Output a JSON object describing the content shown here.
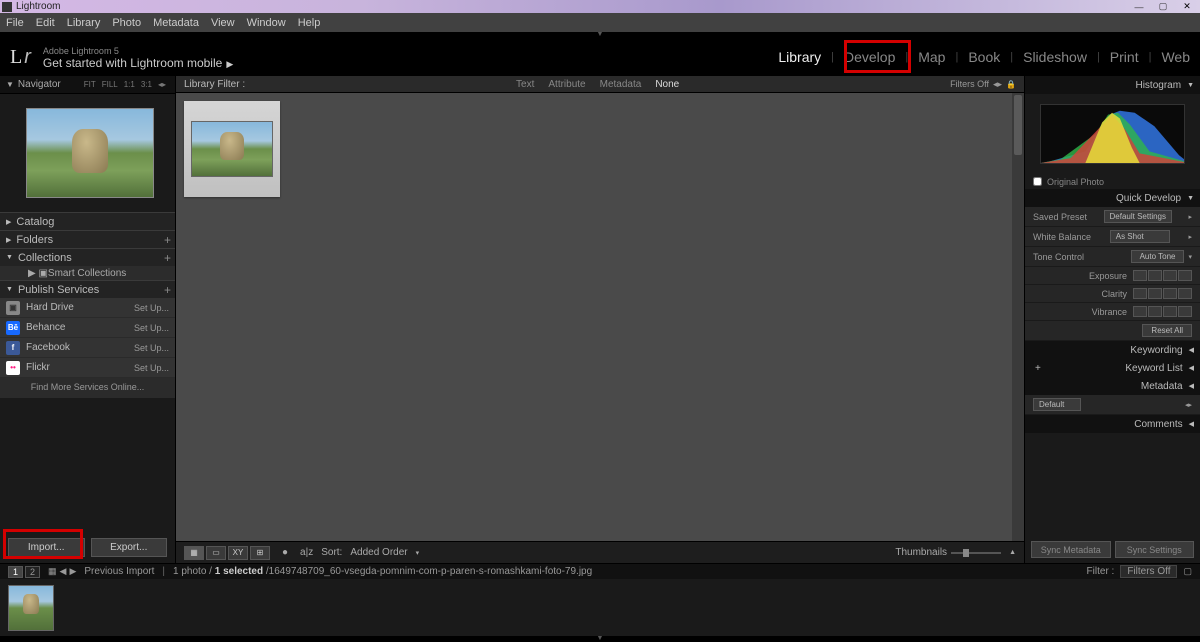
{
  "titlebar": {
    "app": "Lightroom"
  },
  "menubar": [
    "File",
    "Edit",
    "Library",
    "Photo",
    "Metadata",
    "View",
    "Window",
    "Help"
  ],
  "identity": {
    "small": "Adobe Lightroom 5",
    "big": "Get started with Lightroom mobile"
  },
  "modules": [
    "Library",
    "Develop",
    "Map",
    "Book",
    "Slideshow",
    "Print",
    "Web"
  ],
  "active_module": "Library",
  "left": {
    "navigator": {
      "title": "Navigator",
      "buttons": [
        "FIT",
        "FILL",
        "1:1",
        "3:1"
      ]
    },
    "catalog": "Catalog",
    "folders": "Folders",
    "collections": {
      "title": "Collections",
      "sub": "Smart Collections"
    },
    "publish": {
      "title": "Publish Services",
      "services": [
        {
          "icon": "hd",
          "name": "Hard Drive",
          "action": "Set Up..."
        },
        {
          "icon": "be",
          "name": "Behance",
          "action": "Set Up..."
        },
        {
          "icon": "fb",
          "name": "Facebook",
          "action": "Set Up..."
        },
        {
          "icon": "fl",
          "name": "Flickr",
          "action": "Set Up..."
        }
      ],
      "findmore": "Find More Services Online..."
    },
    "import": "Import...",
    "export": "Export..."
  },
  "libfilter": {
    "label": "Library Filter :",
    "tabs": [
      "Text",
      "Attribute",
      "Metadata",
      "None"
    ],
    "selected": "None",
    "right": "Filters Off"
  },
  "toolbar": {
    "sort_label": "Sort:",
    "sort_value": "Added Order",
    "thumb_label": "Thumbnails"
  },
  "right": {
    "histogram": "Histogram",
    "original": "Original Photo",
    "quickdev": {
      "title": "Quick Develop",
      "saved_preset": {
        "label": "Saved Preset",
        "value": "Default Settings"
      },
      "wb": {
        "label": "White Balance",
        "value": "As Shot"
      },
      "tone": {
        "label": "Tone Control",
        "button": "Auto Tone"
      },
      "exposure": "Exposure",
      "clarity": "Clarity",
      "vibrance": "Vibrance",
      "reset": "Reset All"
    },
    "keywording": "Keywording",
    "keywordlist": "Keyword List",
    "metadata": {
      "title": "Metadata",
      "preset": "Default"
    },
    "comments": "Comments",
    "sync_meta": "Sync Metadata",
    "sync_settings": "Sync Settings"
  },
  "status": {
    "pages": [
      "1",
      "2"
    ],
    "previmport": "Previous Import",
    "count": "1 photo /",
    "selected": "1 selected",
    "filename": "/1649748709_60-vsegda-pomnim-com-p-paren-s-romashkami-foto-79.jpg",
    "filter_label": "Filter :",
    "filter_value": "Filters Off"
  }
}
